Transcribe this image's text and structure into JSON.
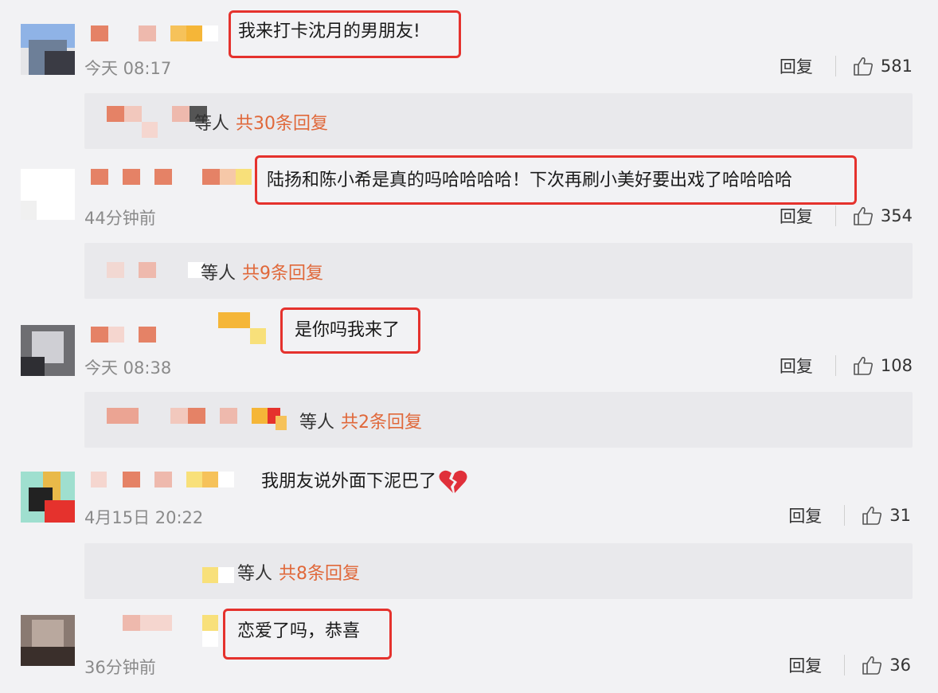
{
  "comments": [
    {
      "text": "我来打卡沈月的男朋友!",
      "time": "今天 08:17",
      "reply_label": "回复",
      "likes": "581",
      "replies": {
        "suffix": "等人",
        "count_text": "共30条回复"
      }
    },
    {
      "text": "陆扬和陈小希是真的吗哈哈哈哈！下次再刷小美好要出戏了哈哈哈哈",
      "time": "44分钟前",
      "reply_label": "回复",
      "likes": "354",
      "replies": {
        "suffix": "等人",
        "count_text": "共9条回复"
      }
    },
    {
      "text": "是你吗我来了",
      "time": "今天 08:38",
      "reply_label": "回复",
      "likes": "108",
      "replies": {
        "suffix": "等人",
        "count_text": "共2条回复"
      }
    },
    {
      "text": "我朋友说外面下泥巴了",
      "time": "4月15日 20:22",
      "reply_label": "回复",
      "likes": "31",
      "replies": {
        "suffix": "等人",
        "count_text": "共8条回复"
      }
    },
    {
      "text": "恋爱了吗，恭喜",
      "time": "36分钟前",
      "reply_label": "回复",
      "likes": "36"
    }
  ],
  "colors": {
    "highlight_border": "#e5322d",
    "reply_count": "#e0683a",
    "time": "#8a8a8a",
    "background": "#f2f2f4",
    "reply_box": "#e9e9ec"
  },
  "icons": {
    "like": "thumbs-up-icon",
    "emoji": "broken-heart-icon"
  }
}
